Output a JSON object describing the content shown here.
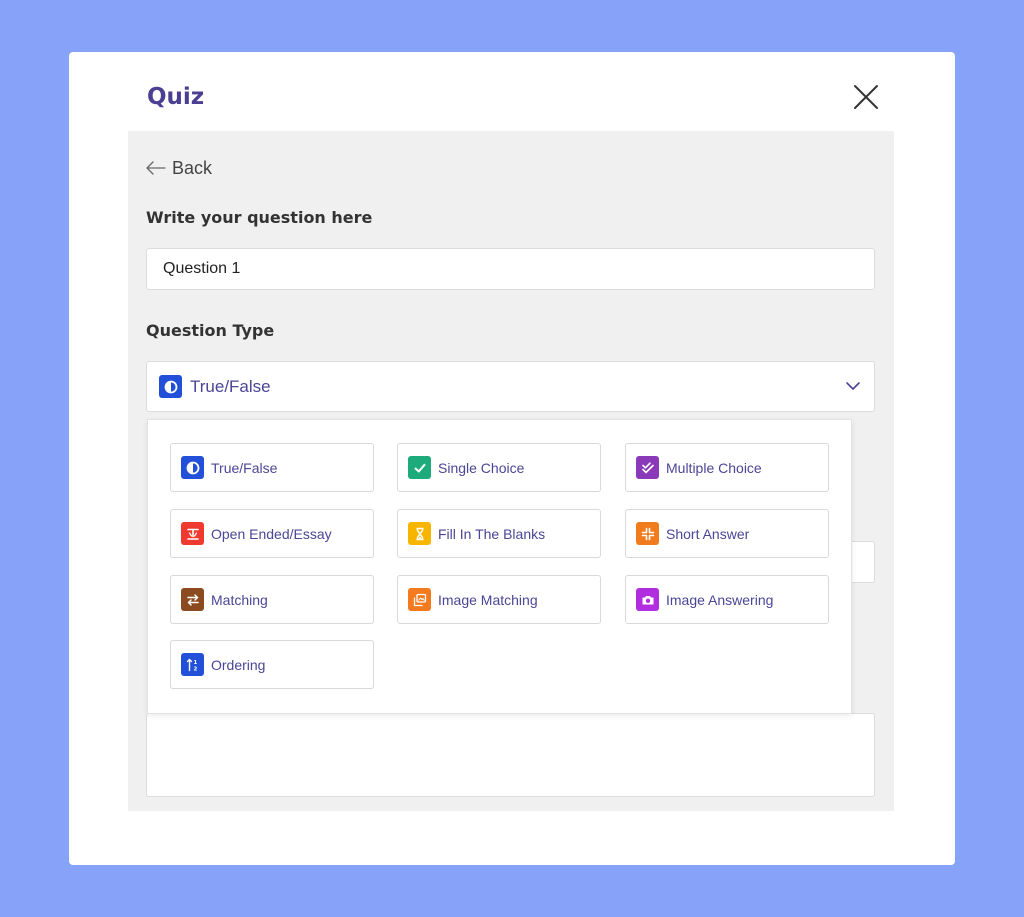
{
  "modal": {
    "title": "Quiz",
    "close_icon": "close-icon"
  },
  "form": {
    "back_label": "Back",
    "question_label": "Write your question here",
    "question_value": "Question 1",
    "type_label": "Question Type",
    "selected_type": {
      "label": "True/False",
      "icon": "half-circle-icon",
      "color": "#2250d8"
    }
  },
  "options": [
    {
      "label": "True/False",
      "icon": "half-circle-icon",
      "color": "#2250d8"
    },
    {
      "label": "Single Choice",
      "icon": "check-icon",
      "color": "#1dab7b"
    },
    {
      "label": "Multiple Choice",
      "icon": "double-check-icon",
      "color": "#8a3ab9"
    },
    {
      "label": "Open Ended/Essay",
      "icon": "text-icon",
      "color": "#ee3a2f"
    },
    {
      "label": "Fill In The Blanks",
      "icon": "hourglass-icon",
      "color": "#f7b500"
    },
    {
      "label": "Short Answer",
      "icon": "compress-icon",
      "color": "#f07c1e"
    },
    {
      "label": "Matching",
      "icon": "swap-icon",
      "color": "#8b4a1f"
    },
    {
      "label": "Image Matching",
      "icon": "images-icon",
      "color": "#f47a20"
    },
    {
      "label": "Image Answering",
      "icon": "camera-icon",
      "color": "#b02ee0"
    },
    {
      "label": "Ordering",
      "icon": "sort-icon",
      "color": "#2250d8"
    }
  ],
  "colors": {
    "backdrop": "#87a2f9",
    "title": "#4a3f92",
    "accent_text": "#4b4596"
  }
}
